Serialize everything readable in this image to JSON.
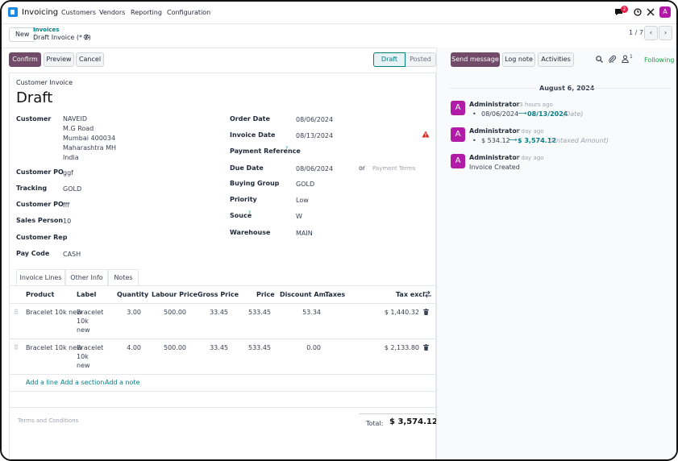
{
  "nav": {
    "app_name": "Invoicing",
    "menu": [
      "Customers",
      "Vendors",
      "Reporting",
      "Configuration"
    ],
    "chat_badge": "2",
    "user_initial": "A"
  },
  "control": {
    "new_label": "New",
    "breadcrumb_parent": "Invoices",
    "breadcrumb_current": "Draft Invoice (* 7)",
    "pager": "1 / 7"
  },
  "actions": {
    "confirm": "Confirm",
    "preview": "Preview",
    "cancel": "Cancel"
  },
  "status": {
    "draft": "Draft",
    "posted": "Posted"
  },
  "invoice": {
    "type_label": "Customer Invoice",
    "state_title": "Draft",
    "left_fields": [
      {
        "label": "Customer",
        "value": "NAVEID"
      },
      {
        "label": "Customer PO",
        "value": "ggf"
      },
      {
        "label": "Tracking",
        "value": "GOLD"
      },
      {
        "label": "Customer PO",
        "value": "fff"
      },
      {
        "label": "Sales Person",
        "value": "10"
      },
      {
        "label": "Customer Rep",
        "value": ""
      },
      {
        "label": "Pay Code",
        "value": "CASH"
      }
    ],
    "address_lines": [
      "M.G Road",
      "Mumbai 400034",
      "Maharashtra MH",
      "India"
    ],
    "right_fields": [
      {
        "label": "Order Date",
        "value": "08/06/2024"
      },
      {
        "label": "Invoice Date",
        "value": "08/13/2024"
      },
      {
        "label": "Payment Reference",
        "value": ""
      },
      {
        "label": "Due Date",
        "value": "08/06/2024"
      },
      {
        "label": "Buying Group",
        "value": "GOLD"
      },
      {
        "label": "Priority",
        "value": "Low"
      },
      {
        "label": "Souce",
        "value": "W"
      },
      {
        "label": "Warehouse",
        "value": "MAIN"
      }
    ],
    "help_mark": "?",
    "due_or": "or",
    "payment_terms_placeholder": "Payment Terms"
  },
  "tabs": [
    "Invoice Lines",
    "Other Info",
    "Notes"
  ],
  "lines": {
    "headers": [
      "Product",
      "Label",
      "Quantity",
      "Labour Price",
      "Gross Price",
      "Price",
      "Discount Am...",
      "Taxes",
      "Tax excl."
    ],
    "rows": [
      {
        "product": "Bracelet 10k new",
        "label_lines": [
          "Bracelet",
          "10k",
          "new"
        ],
        "quantity": "3.00",
        "labour_price": "500.00",
        "gross_price": "33.45",
        "price": "533.45",
        "discount": "53.34",
        "taxes": "",
        "tax_excl": "$ 1,440.32"
      },
      {
        "product": "Bracelet 10k new",
        "label_lines": [
          "Bracelet",
          "10k",
          "new"
        ],
        "quantity": "4.00",
        "labour_price": "500.00",
        "gross_price": "33.45",
        "price": "533.45",
        "discount": "0.00",
        "taxes": "",
        "tax_excl": "$ 2,133.80"
      }
    ],
    "add_line": "Add a line",
    "add_section": "Add a section",
    "add_note": "Add a note"
  },
  "footer": {
    "terms_placeholder": "Terms and Conditions",
    "total_label": "Total:",
    "total_value": "$ 3,574.12"
  },
  "chatter": {
    "send_message": "Send message",
    "log_note": "Log note",
    "activities": "Activities",
    "followers_count": "1",
    "following": "Following",
    "date_separator": "August 6, 2024",
    "messages": [
      {
        "author": "Administrator",
        "time": "- 23 hours ago",
        "old": "08/06/2024",
        "new": "08/13/2024",
        "field": "(Date)"
      },
      {
        "author": "Administrator",
        "time": "- 1 day ago",
        "old": "$ 534.12",
        "new": "$ 3,574.12",
        "field": "(Untaxed Amount)"
      },
      {
        "author": "Administrator",
        "time": "- 1 day ago",
        "body": "Invoice Created"
      }
    ],
    "avatar_initial": "A"
  },
  "colors": {
    "brand": "#714b67",
    "accent_teal": "#017e84",
    "avatar": "#b21ba8",
    "danger": "#dc2626"
  }
}
